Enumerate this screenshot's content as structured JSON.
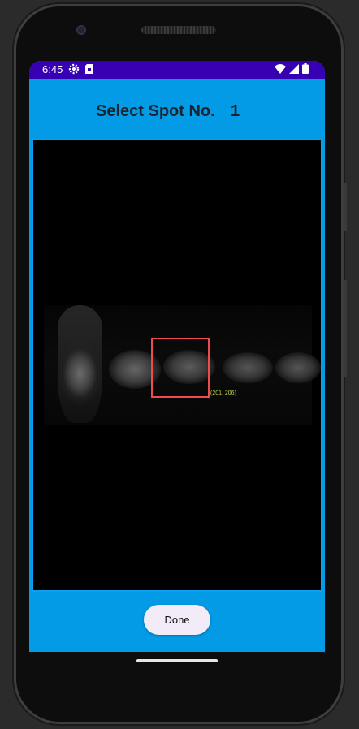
{
  "status_bar": {
    "time": "6:45",
    "left_icons": [
      "settings-gear-icon",
      "sim-card-icon"
    ],
    "right_icons": [
      "wifi-icon",
      "signal-icon",
      "battery-icon"
    ],
    "color": "#3700b3"
  },
  "header": {
    "title": "Select Spot No.",
    "spot_number": "1"
  },
  "image_view": {
    "selection_coords": "(201, 206)",
    "selection_color": "#ef4b4b",
    "band_count": 5
  },
  "actions": {
    "done_label": "Done"
  },
  "theme": {
    "primary": "#039be5",
    "accent": "#3700b3"
  }
}
